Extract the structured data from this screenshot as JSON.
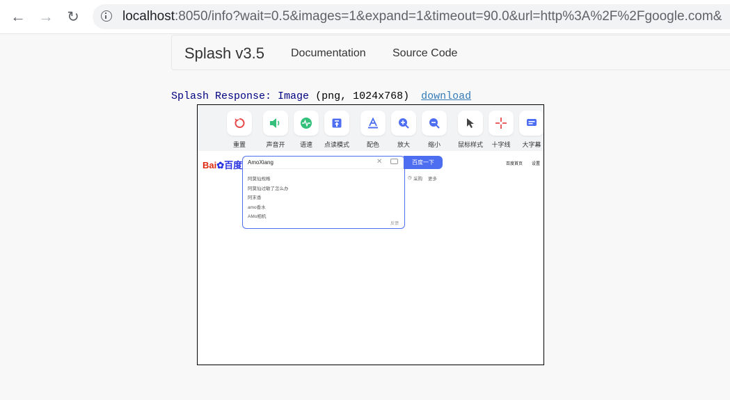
{
  "browser": {
    "url_host": "localhost",
    "url_rest": ":8050/info?wait=0.5&images=1&expand=1&timeout=90.0&url=http%3A%2F%2Fgoogle.com&",
    "back_icon": "arrow-left-icon",
    "forward_icon": "arrow-right-icon",
    "reload_icon": "reload-icon"
  },
  "navbar": {
    "brand": "Splash v3.5",
    "links": [
      "Documentation",
      "Source Code"
    ]
  },
  "response": {
    "label": "Splash Response:",
    "type": "Image",
    "meta": "(png, 1024x768)",
    "download": "download"
  },
  "toolbar": {
    "tools": [
      {
        "label": "重置",
        "icon": "reset-icon",
        "color": "#e84a4a"
      },
      {
        "label": "声音开",
        "icon": "sound-icon",
        "color": "#34c07a"
      },
      {
        "label": "语速",
        "icon": "speed-icon",
        "color": "#34c07a"
      },
      {
        "label": "点读模式",
        "icon": "read-mode-icon",
        "color": "#4e6ef2"
      },
      {
        "label": "配色",
        "icon": "color-icon",
        "color": "#4e6ef2"
      },
      {
        "label": "放大",
        "icon": "zoom-in-icon",
        "color": "#4e6ef2"
      },
      {
        "label": "缩小",
        "icon": "zoom-out-icon",
        "color": "#4e6ef2"
      },
      {
        "label": "鼠标样式",
        "icon": "cursor-icon",
        "color": "#444444"
      },
      {
        "label": "十字线",
        "icon": "crosshair-icon",
        "color": "#e84a4a"
      },
      {
        "label": "大字幕",
        "icon": "caption-icon",
        "color": "#4e6ef2"
      }
    ]
  },
  "baidu": {
    "logo_a": "Bai",
    "logo_b": "百度",
    "query": "AmoXiang",
    "button": "百度一下",
    "suggestions": [
      "阿莫仙规格",
      "阿莫仙过敏了怎么办",
      "阿末香",
      "amo香水",
      "AMo相机"
    ],
    "feedback": "反馈",
    "right_links": [
      "百度首页",
      "设置"
    ],
    "under_links": [
      "采购",
      "更多"
    ]
  }
}
